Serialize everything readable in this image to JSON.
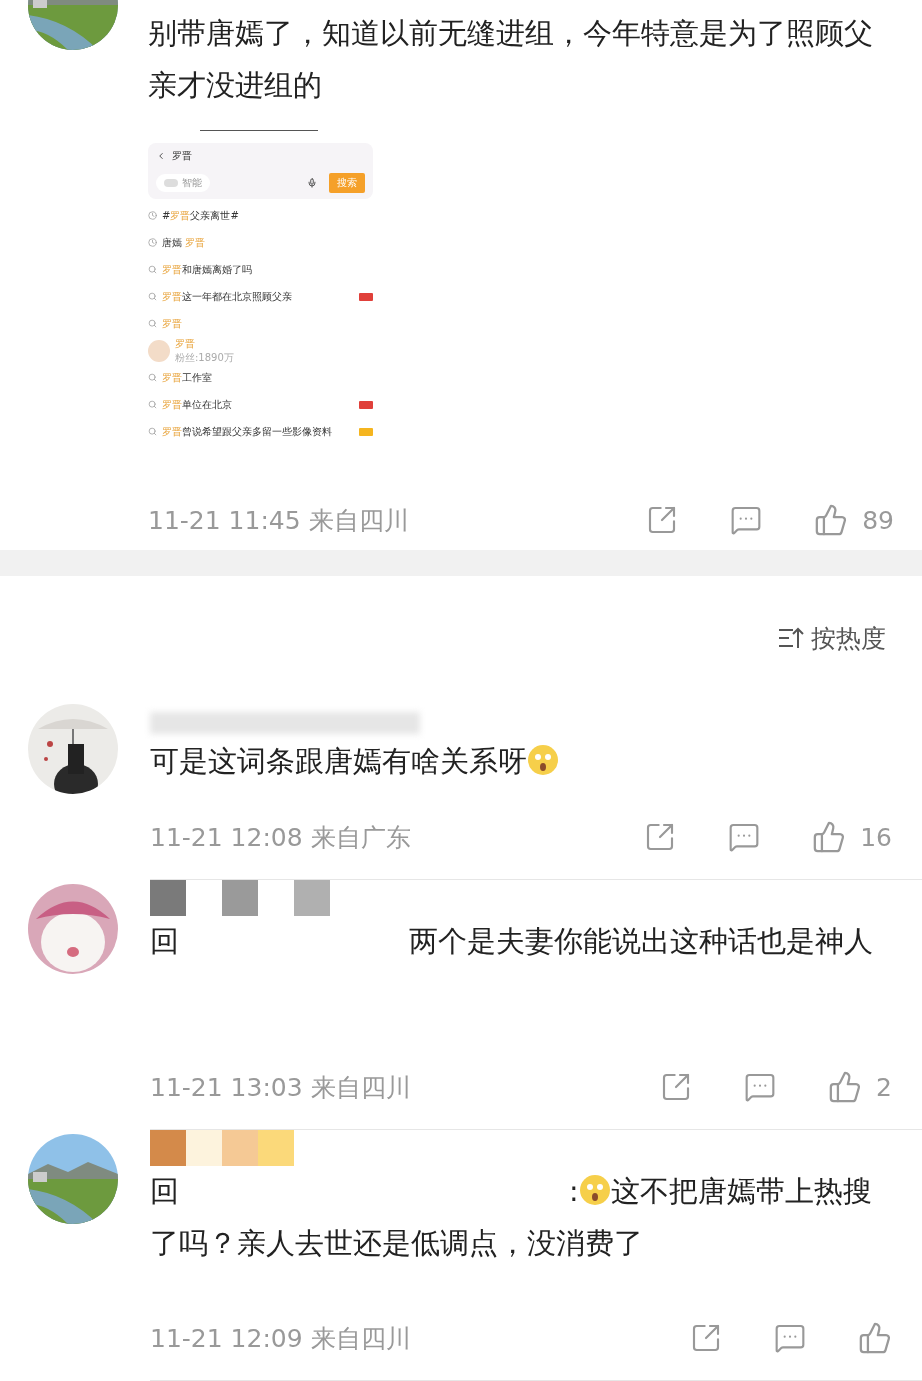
{
  "top_comment": {
    "text": "别带唐嫣了，知道以前无缝进组，今年特意是为了照顾父亲才没进组的",
    "screenshot": {
      "search_value": "罗晋",
      "toggle_label": "智能",
      "toggle_on": false,
      "search_button": "搜索",
      "suggestions": [
        {
          "kind": "history",
          "pre": "#",
          "key": "罗晋",
          "post": "父亲离世#"
        },
        {
          "kind": "history",
          "pre": "唐嫣 ",
          "key": "罗晋"
        },
        {
          "kind": "search",
          "key": "罗晋",
          "post": "和唐嫣离婚了吗"
        },
        {
          "kind": "search",
          "key": "罗晋",
          "post": "这一年都在北京照顾父亲",
          "color": "#e0403a"
        },
        {
          "kind": "search",
          "key": "罗晋"
        },
        {
          "kind": "user",
          "key": "罗晋",
          "sub": "粉丝:1890万"
        },
        {
          "kind": "search",
          "key": "罗晋",
          "post": "工作室"
        },
        {
          "kind": "search",
          "key": "罗晋",
          "post": "单位在北京",
          "color": "#e0403a"
        },
        {
          "kind": "search",
          "key": "罗晋",
          "post": "曾说希望跟父亲多留一些影像资料",
          "color": "#f5b51f"
        }
      ]
    },
    "time": "11-21 11:45",
    "location": "来自四川",
    "likes": "89"
  },
  "sort": {
    "label": "按热度"
  },
  "comments": [
    {
      "segments": [
        {
          "kind": "text",
          "text": "可是这词条跟唐嫣有啥关系呀"
        },
        {
          "kind": "emoji"
        }
      ],
      "time": "11-21 12:08",
      "location": "来自广东",
      "likes": "16"
    },
    {
      "mosaic": [
        {
          "color": "#7a7a7a"
        },
        {
          "color": "#9a9a9a"
        },
        {
          "color": "#b0b0b0"
        }
      ],
      "segments": [
        {
          "kind": "text",
          "text": "回"
        },
        {
          "kind": "gap"
        },
        {
          "kind": "text",
          "text": "两个是夫妻你能说出这种话也是神人"
        }
      ],
      "time": "11-21 13:03",
      "location": "来自四川",
      "likes": "2"
    },
    {
      "mosaic": [
        {
          "color": "#d48a4a"
        },
        {
          "color": "#fdf3dd"
        },
        {
          "color": "#f5c995"
        },
        {
          "color": "#fbd97a"
        }
      ],
      "segments": [
        {
          "kind": "text",
          "text": "回"
        },
        {
          "kind": "gap"
        },
        {
          "kind": "text",
          "text": ":"
        },
        {
          "kind": "emoji"
        },
        {
          "kind": "text",
          "text": "这不把唐嫣带上热搜了吗？亲人去世还是低调点，没消费了"
        }
      ],
      "time": "11-21 12:09",
      "location": "来自四川"
    }
  ]
}
